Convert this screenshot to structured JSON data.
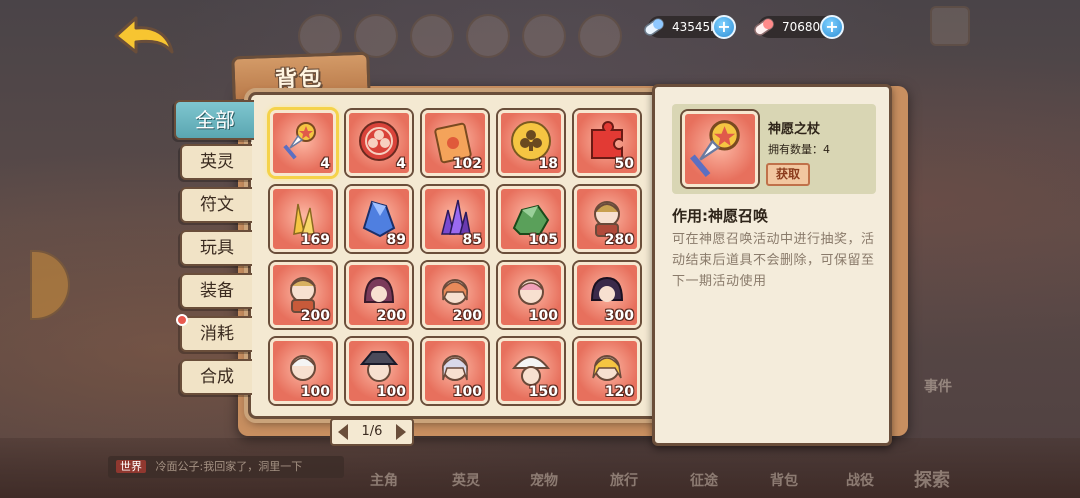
{
  "header": {
    "back_label": "",
    "currency": [
      {
        "amount": "43545k",
        "icon": "pink-capsule-icon",
        "color": "#8fd3ff"
      },
      {
        "amount": "70680",
        "icon": "red-capsule-icon",
        "color": "#ff8a8a"
      }
    ]
  },
  "background": {
    "news_tag": "世界",
    "news_text": "冷面公子:我回家了，洞里一下",
    "nav_labels": [
      "主角",
      "英灵",
      "宠物",
      "旅行",
      "征途",
      "背包",
      "战役",
      "探索"
    ],
    "event_label": "事件"
  },
  "panel": {
    "title": "背包",
    "tabs": [
      {
        "label": "全部",
        "active": true
      },
      {
        "label": "英灵",
        "active": false
      },
      {
        "label": "符文",
        "active": false
      },
      {
        "label": "玩具",
        "active": false
      },
      {
        "label": "装备",
        "active": false
      },
      {
        "label": "消耗",
        "active": false,
        "badge": true
      },
      {
        "label": "合成",
        "active": false
      }
    ],
    "items": [
      {
        "icon": "wish-staff-icon",
        "count": "4",
        "selected": true
      },
      {
        "icon": "club-token-red-icon",
        "count": "4"
      },
      {
        "icon": "ticket-icon",
        "count": "102"
      },
      {
        "icon": "club-coin-gold-icon",
        "count": "18"
      },
      {
        "icon": "puzzle-piece-icon",
        "count": "50"
      },
      {
        "icon": "gold-crystal-icon",
        "count": "169"
      },
      {
        "icon": "blue-crystal-icon",
        "count": "89"
      },
      {
        "icon": "purple-crystal-icon",
        "count": "85"
      },
      {
        "icon": "green-ore-icon",
        "count": "105"
      },
      {
        "icon": "hero-shard-knight-icon",
        "count": "280"
      },
      {
        "icon": "hero-shard-armor-icon",
        "count": "200"
      },
      {
        "icon": "hero-shard-hood-icon",
        "count": "200"
      },
      {
        "icon": "hero-shard-girl-icon",
        "count": "200"
      },
      {
        "icon": "hero-shard-pink-icon",
        "count": "100"
      },
      {
        "icon": "hero-shard-dark-icon",
        "count": "300"
      },
      {
        "icon": "hero-shard-white-icon",
        "count": "100"
      },
      {
        "icon": "hero-shard-hat-icon",
        "count": "100"
      },
      {
        "icon": "hero-shard-silver-icon",
        "count": "100"
      },
      {
        "icon": "hero-shard-mushroom-icon",
        "count": "150"
      },
      {
        "icon": "hero-shard-blonde-icon",
        "count": "120"
      }
    ],
    "pager": "1/6"
  },
  "detail": {
    "name": "神愿之杖",
    "owned": "拥有数量：4",
    "get_label": "获取",
    "effect": "作用:神愿召唤",
    "description": "可在神愿召唤活动中进行抽奖，活动结束后道具不会删除，可保留至下一期活动使用"
  }
}
